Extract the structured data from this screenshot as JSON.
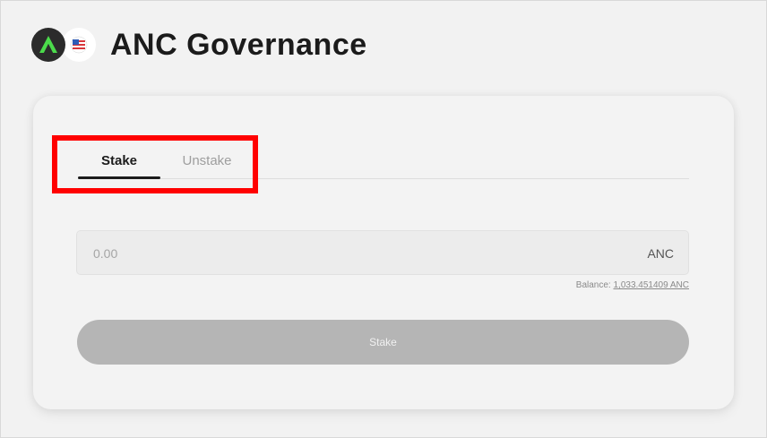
{
  "header": {
    "title": "ANC Governance",
    "logos": [
      "anchor-logo-icon",
      "us-flag-icon"
    ]
  },
  "tabs": [
    {
      "label": "Stake",
      "active": true
    },
    {
      "label": "Unstake",
      "active": false
    }
  ],
  "amount": {
    "placeholder": "0.00",
    "value": "",
    "unit": "ANC"
  },
  "balance": {
    "label": "Balance:",
    "value": "1,033.451409 ANC"
  },
  "submit": {
    "label": "Stake"
  },
  "colors": {
    "highlight": "#ff0000",
    "button_disabled": "#b5b5b5",
    "anchor_green": "#4bdb4b"
  }
}
